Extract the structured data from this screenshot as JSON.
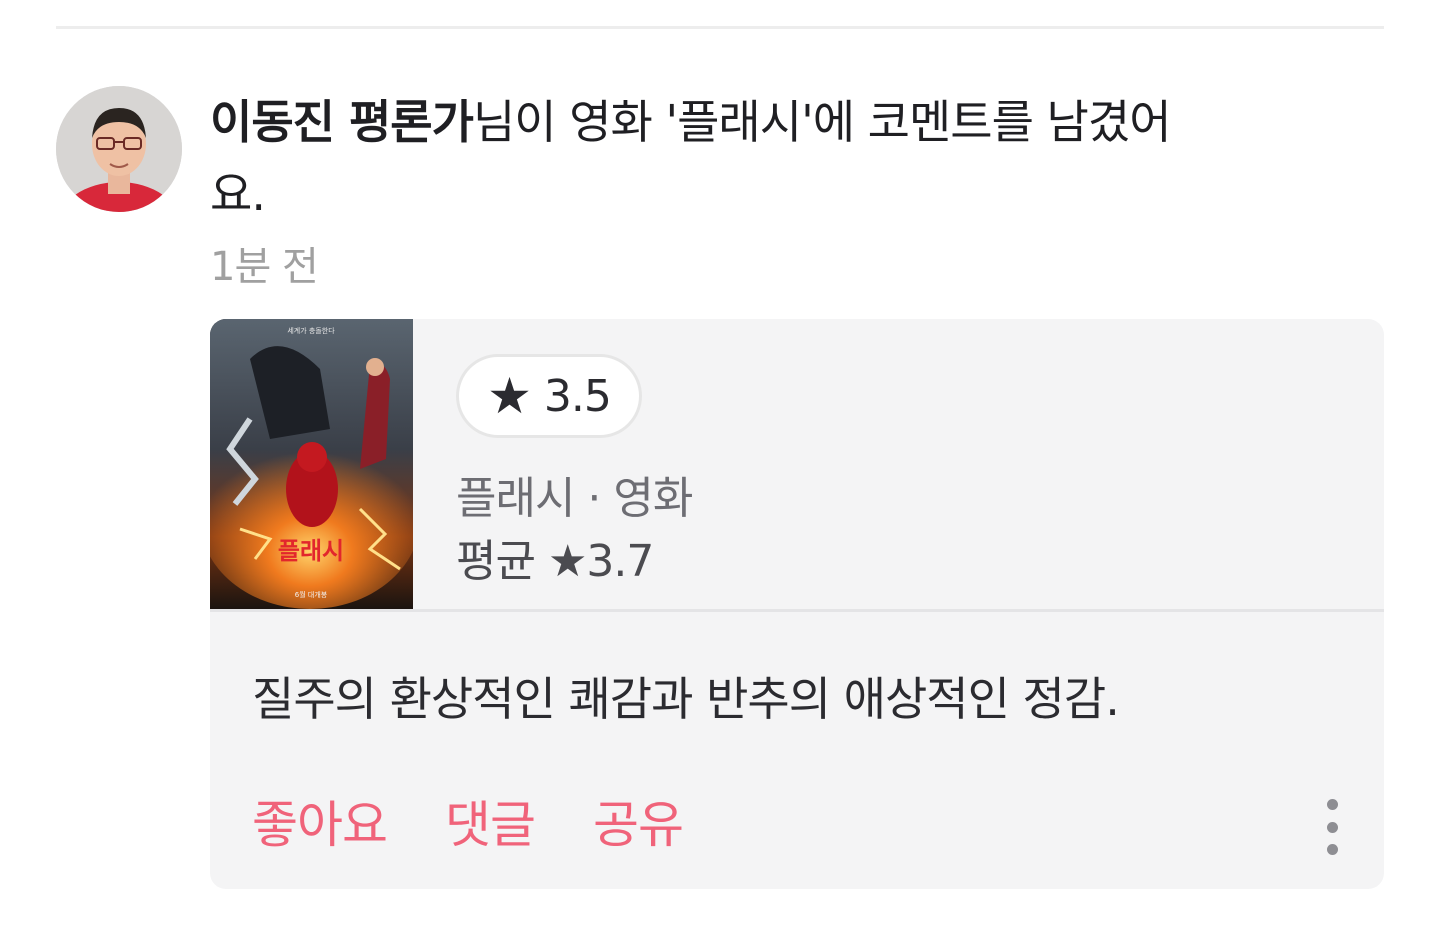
{
  "feed_item": {
    "author": "이동진 평론가",
    "action_text": "님이 영화 '플래시'에 코멘트를 남겼어요.",
    "time_ago": "1분 전"
  },
  "card": {
    "user_rating": "3.5",
    "rating_star": "★",
    "meta": "플래시 · 영화",
    "average_label": "평균 ★3.7",
    "poster_text": {
      "tagline": "세계가 충돌한다",
      "title_logo": "플래시",
      "release": "6월 대개봉"
    },
    "comment": "질주의 환상적인 쾌감과 반추의 애상적인 정감.",
    "actions": {
      "like": "좋아요",
      "comment": "댓글",
      "share": "공유"
    }
  },
  "colors": {
    "accent": "#f0637a",
    "card_bg": "#f4f4f5",
    "muted_text": "#a0a0a0"
  },
  "icons": {
    "more": "more-vertical-icon",
    "star": "star-icon"
  }
}
